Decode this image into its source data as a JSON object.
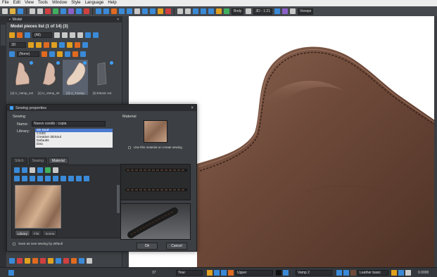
{
  "menubar": {
    "items": [
      "File",
      "Edit",
      "View",
      "Tools",
      "Window",
      "Style",
      "Language",
      "Help"
    ]
  },
  "toolbar": {
    "body_field": "Body",
    "view_field": "3D - 1:21",
    "right_label": "Viewpo",
    "colors": [
      "#e0e0e0",
      "#d04040",
      "#3a8ad8",
      "#e0a020",
      "#40b060",
      "#8a60c8",
      "#e06a20",
      "#c8c8c8"
    ]
  },
  "panel": {
    "title": "Model",
    "pieces_title": "Model pieces list (1 of 14) (3)",
    "filter_value": "(All)",
    "mode_value": "3D",
    "none_value": "(None)",
    "pieces": [
      {
        "label": "[2] U_Vamp_ext",
        "color": "#d9b8a8"
      },
      {
        "label": "[1] U_Vamp_int",
        "color": "#d9b8a8"
      },
      {
        "label": "[3] U_Tvamp",
        "color": "#e8d2c0"
      },
      {
        "label": "[3] Elastic ext",
        "color": "#5a5e64"
      }
    ]
  },
  "dialog": {
    "title": "Sewing properties",
    "sewing_label": "Sewing",
    "material_label": "Material",
    "name_label": "Name:",
    "name_value": "Nuevo cosido : copia",
    "library_label": "Library:",
    "library_items": [
      "3D Soul",
      "CS3D",
      "Creative 3DSoul",
      "Defaults",
      "Disc"
    ],
    "library_selected": "3D Soul",
    "use_material_label": "Use this material on create sewing",
    "tabs": [
      "Stitch",
      "Sewing",
      "Material"
    ],
    "active_tab": "Material",
    "subtabs": [
      "Library",
      "File",
      "Scene"
    ],
    "active_subtab": "Library",
    "save_default_label": "Save as new sewing by default",
    "ok_label": "Ok",
    "cancel_label": "Cancel"
  },
  "statusbar": {
    "value_left": "37",
    "year_value": "Year",
    "upper_value": "Upper",
    "vamp_value": "Vamp 2",
    "material_value": "Leather basic",
    "zoom_value": "0.0000"
  },
  "colors": {
    "accent": "#3fa0ff",
    "leather": "#6f4a3a",
    "selection": "#4a7ad0"
  }
}
